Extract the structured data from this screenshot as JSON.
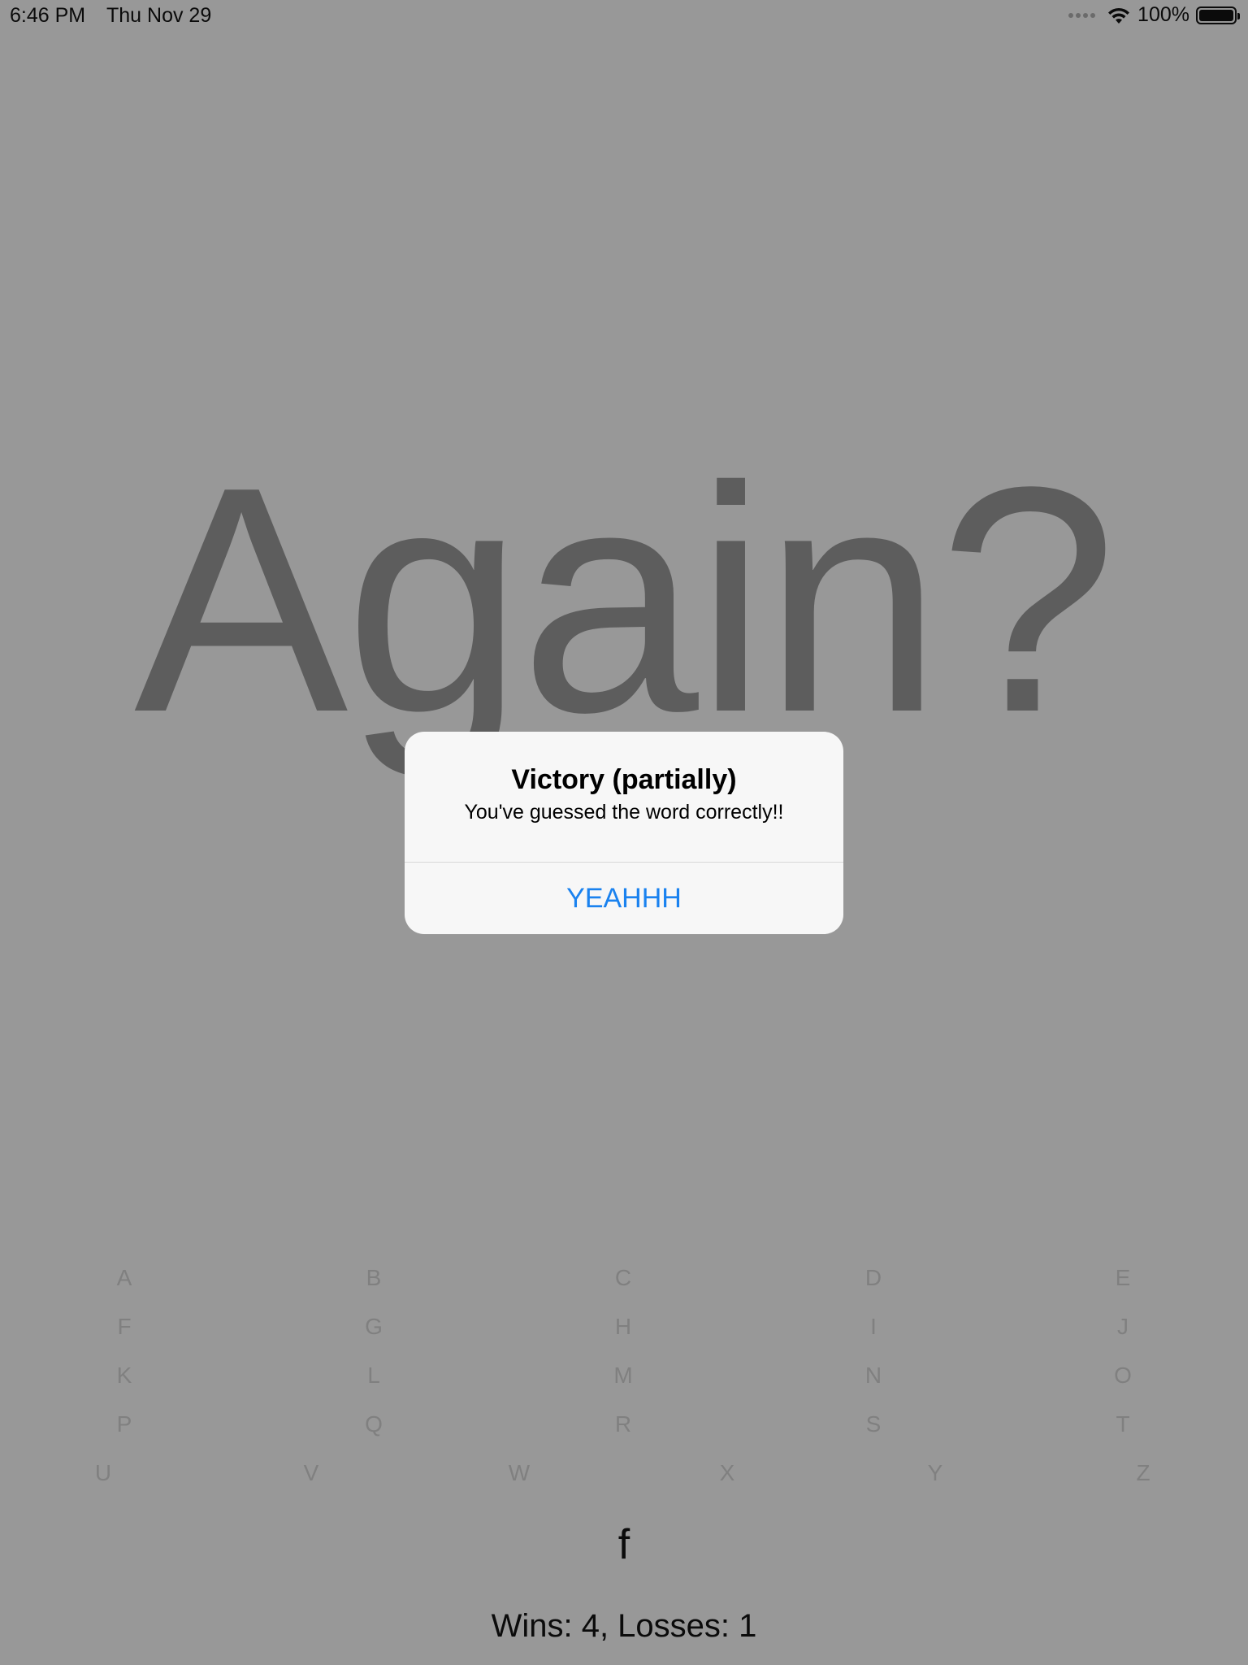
{
  "status_bar": {
    "time": "6:46 PM",
    "date": "Thu Nov 29",
    "battery_percent": "100%",
    "icons": [
      "cellular-dots-icon",
      "wifi-icon",
      "battery-icon"
    ]
  },
  "game": {
    "big_word": "Again?",
    "current_guess": "f",
    "score_text": "Wins: 4, Losses: 1"
  },
  "alert": {
    "title": "Victory (partially)",
    "message": "You've guessed the word correctly!!",
    "button_label": "YEAHHH"
  },
  "letters": [
    [
      "A",
      "B",
      "C",
      "D",
      "E"
    ],
    [
      "F",
      "G",
      "H",
      "I",
      "J"
    ],
    [
      "K",
      "L",
      "M",
      "N",
      "O"
    ],
    [
      "P",
      "Q",
      "R",
      "S",
      "T"
    ],
    [
      "U",
      "V",
      "W",
      "X",
      "Y",
      "Z"
    ]
  ],
  "colors": {
    "dimmed_background": "#989898",
    "big_word": "#5d5d5d",
    "alert_button": "#1a82ef",
    "letter": "#808080"
  }
}
